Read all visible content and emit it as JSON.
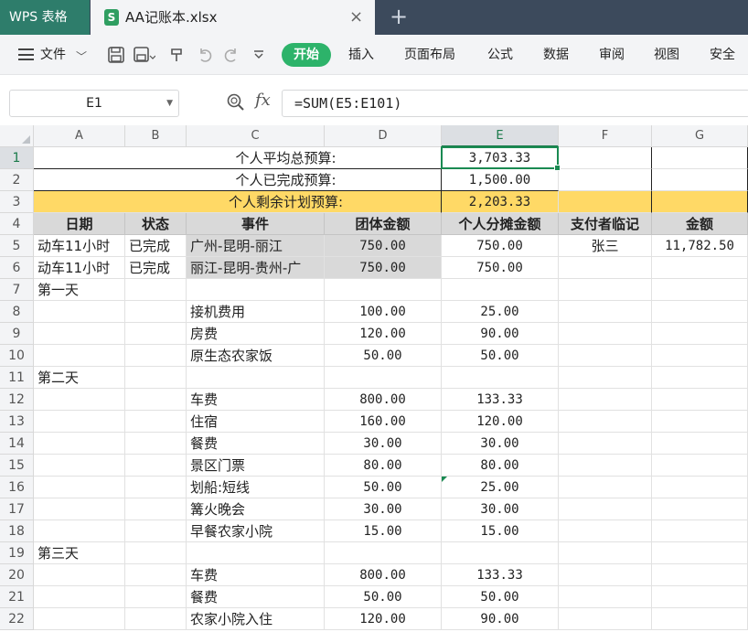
{
  "tabs": {
    "home_label": "WPS 表格",
    "file_icon_letter": "S",
    "file_name": "AA记账本.xlsx",
    "close_glyph": "×",
    "new_tab_glyph": "+"
  },
  "menu": {
    "file_label": "文件",
    "dropdown_glyph": "﹀",
    "start_label": "开始",
    "items": [
      "插入",
      "页面布局",
      "公式",
      "数据",
      "审阅",
      "视图",
      "安全"
    ]
  },
  "formula_bar": {
    "cell_ref": "E1",
    "fx_label": "fx",
    "formula": "=SUM(E5:E101)"
  },
  "grid": {
    "columns": [
      "A",
      "B",
      "C",
      "D",
      "E",
      "F",
      "G"
    ],
    "selected_column": "E",
    "rows": [
      "1",
      "2",
      "3",
      "4",
      "5",
      "6",
      "7",
      "8",
      "9",
      "10",
      "11",
      "12",
      "13",
      "14",
      "15",
      "16",
      "17",
      "18",
      "19",
      "20",
      "21",
      "22"
    ],
    "selected_row": "1",
    "summary": [
      {
        "label": "个人平均总预算:",
        "value": "3,703.33"
      },
      {
        "label": "个人已完成预算:",
        "value": "1,500.00"
      },
      {
        "label": "个人剩余计划预算:",
        "value": "2,203.33"
      }
    ],
    "headers": [
      "日期",
      "状态",
      "事件",
      "团体金额",
      "个人分摊金额",
      "支付者临记",
      "金额"
    ],
    "body": [
      {
        "a": "动车11小时",
        "b": "已完成",
        "c": "广州-昆明-丽江",
        "d": "750.00",
        "e": "750.00",
        "f": "张三",
        "g": "11,782.50"
      },
      {
        "a": "动车11小时",
        "b": "已完成",
        "c": "丽江-昆明-贵州-广",
        "d": "750.00",
        "e": "750.00",
        "f": "",
        "g": ""
      },
      {
        "a": "第一天",
        "b": "",
        "c": "",
        "d": "",
        "e": "",
        "f": "",
        "g": ""
      },
      {
        "a": "",
        "b": "",
        "c": "接机费用",
        "d": "100.00",
        "e": "25.00",
        "f": "",
        "g": ""
      },
      {
        "a": "",
        "b": "",
        "c": "房费",
        "d": "120.00",
        "e": "90.00",
        "f": "",
        "g": ""
      },
      {
        "a": "",
        "b": "",
        "c": "原生态农家饭",
        "d": "50.00",
        "e": "50.00",
        "f": "",
        "g": ""
      },
      {
        "a": "第二天",
        "b": "",
        "c": "",
        "d": "",
        "e": "",
        "f": "",
        "g": ""
      },
      {
        "a": "",
        "b": "",
        "c": "车费",
        "d": "800.00",
        "e": "133.33",
        "f": "",
        "g": ""
      },
      {
        "a": "",
        "b": "",
        "c": "住宿",
        "d": "160.00",
        "e": "120.00",
        "f": "",
        "g": ""
      },
      {
        "a": "",
        "b": "",
        "c": "餐费",
        "d": "30.00",
        "e": "30.00",
        "f": "",
        "g": ""
      },
      {
        "a": "",
        "b": "",
        "c": "景区门票",
        "d": "80.00",
        "e": "80.00",
        "f": "",
        "g": ""
      },
      {
        "a": "",
        "b": "",
        "c": "划船:短线",
        "d": "50.00",
        "e": "25.00",
        "f": "",
        "g": ""
      },
      {
        "a": "",
        "b": "",
        "c": "篝火晚会",
        "d": "30.00",
        "e": "30.00",
        "f": "",
        "g": ""
      },
      {
        "a": "",
        "b": "",
        "c": "早餐农家小院",
        "d": "15.00",
        "e": "15.00",
        "f": "",
        "g": ""
      },
      {
        "a": "第三天",
        "b": "",
        "c": "",
        "d": "",
        "e": "",
        "f": "",
        "g": ""
      },
      {
        "a": "",
        "b": "",
        "c": "车费",
        "d": "800.00",
        "e": "133.33",
        "f": "",
        "g": ""
      },
      {
        "a": "",
        "b": "",
        "c": "餐费",
        "d": "50.00",
        "e": "50.00",
        "f": "",
        "g": ""
      },
      {
        "a": "",
        "b": "",
        "c": "农家小院入住",
        "d": "120.00",
        "e": "90.00",
        "f": "",
        "g": ""
      }
    ]
  }
}
